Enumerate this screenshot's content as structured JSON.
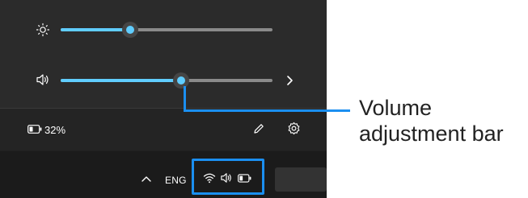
{
  "brightness_slider": {
    "value_percent": 33
  },
  "volume_slider": {
    "value_percent": 57
  },
  "status": {
    "battery_percent_label": "32%"
  },
  "taskbar": {
    "language_label": "ENG"
  },
  "callout": {
    "line1": "Volume",
    "line2": "adjustment bar"
  },
  "colors": {
    "accent": "#60cdff",
    "highlight": "#1b8ff0",
    "panel": "#2b2b2b"
  },
  "icons": [
    "brightness-icon",
    "volume-icon",
    "chevron-right-icon",
    "battery-icon",
    "edit-icon",
    "settings-icon",
    "chevron-up-icon",
    "wifi-icon"
  ]
}
